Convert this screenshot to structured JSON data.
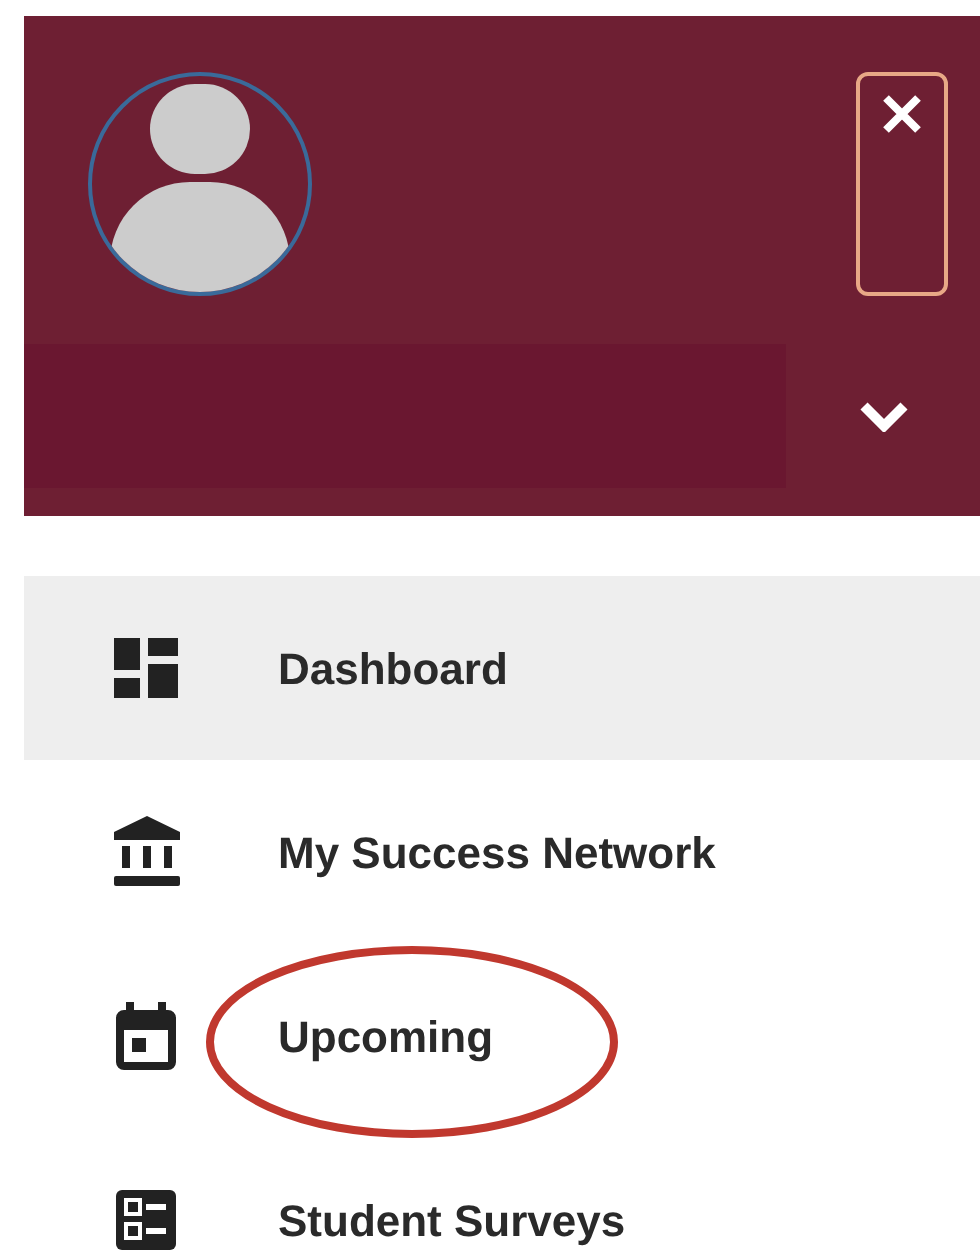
{
  "header": {
    "expanded": false
  },
  "menu": [
    {
      "label": "Dashboard",
      "selected": true,
      "circled": false
    },
    {
      "label": "My Success Network",
      "selected": false,
      "circled": false
    },
    {
      "label": "Upcoming",
      "selected": false,
      "circled": true
    },
    {
      "label": "Student Surveys",
      "selected": false,
      "circled": false
    }
  ]
}
